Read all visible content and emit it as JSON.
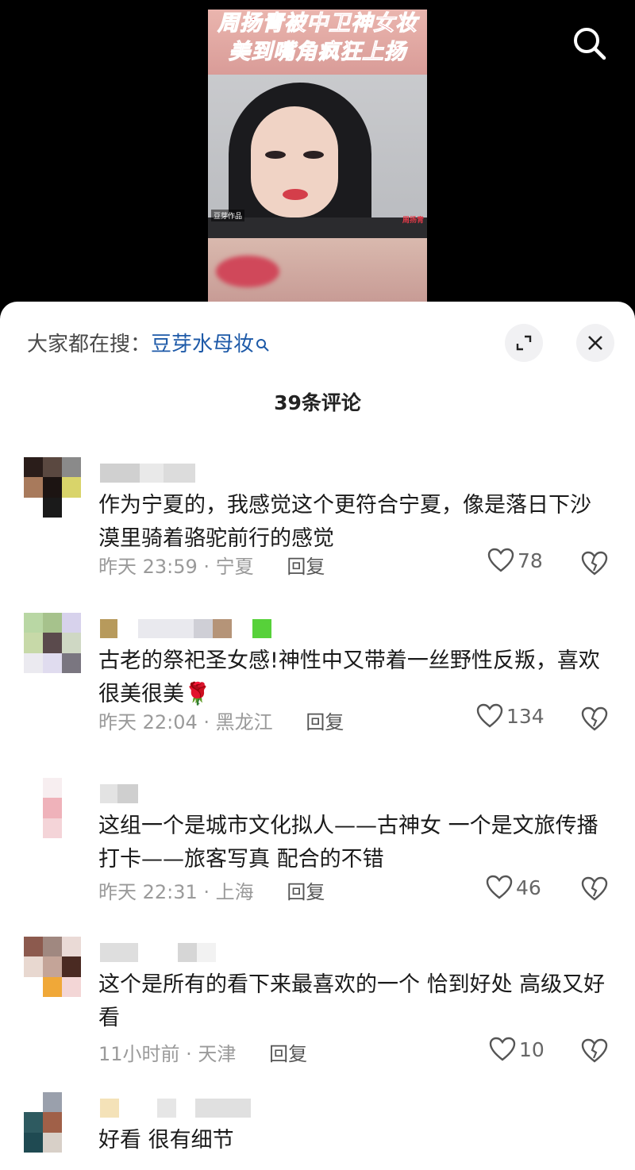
{
  "video": {
    "caption_line1": "周扬青被中卫神女妆",
    "caption_line2": "美到嘴角疯狂上扬",
    "watermark_left": "豆芽作品",
    "watermark_right": "周扬青"
  },
  "sheet": {
    "hot_search_label": "大家都在搜：",
    "hot_search_term": "豆芽水母妆",
    "comment_count_title": "39条评论",
    "reply_label": "回复"
  },
  "comments": [
    {
      "text": "作为宁夏的，我感觉这个更符合宁夏，像是落日下沙漠里骑着骆驼前行的感觉",
      "time_location": "昨天 23:59 · 宁夏",
      "likes": "78"
    },
    {
      "text": "古老的祭祀圣女感!神性中又带着一丝野性反叛，喜欢很美很美🌹",
      "time_location": "昨天 22:04 · 黑龙江",
      "likes": "134"
    },
    {
      "text": "这组一个是城市文化拟人——古神女 一个是文旅传播打卡——旅客写真 配合的不错",
      "time_location": "昨天 22:31 · 上海",
      "likes": "46"
    },
    {
      "text": "这个是所有的看下来最喜欢的一个 恰到好处 高级又好看",
      "time_location": "11小时前 · 天津",
      "likes": "10"
    },
    {
      "text": "好看 很有细节"
    }
  ],
  "icons": {
    "search": "search-icon",
    "expand": "expand-icon",
    "close": "close-icon",
    "like": "heart-outline-icon",
    "dislike": "broken-heart-icon"
  },
  "colors": {
    "hot_search_term": "#1e5aa8",
    "caption_red": "#e23a48"
  }
}
